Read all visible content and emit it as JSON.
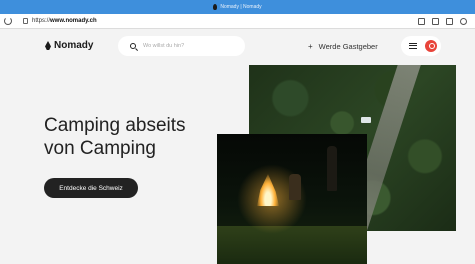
{
  "browser": {
    "title": "Nomady | Nomady",
    "url_prefix": "https://",
    "url_domain": "www.nomady.ch"
  },
  "header": {
    "logo_text": "Nomady",
    "search_placeholder": "Wo willst du hin?",
    "host_label": "Werde Gastgeber",
    "host_icon": "+"
  },
  "hero": {
    "headline_line1": "Camping abseits",
    "headline_line2": "von Camping",
    "cta_label": "Entdecke die Schweiz"
  },
  "colors": {
    "accent": "#e8443a",
    "dark": "#222222",
    "titlebar": "#3e8fdc"
  }
}
